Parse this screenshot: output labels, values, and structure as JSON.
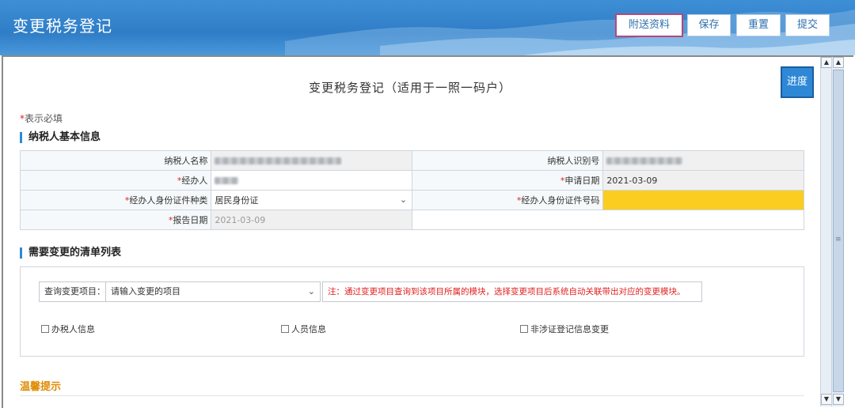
{
  "header": {
    "title": "变更税务登记",
    "buttons": {
      "attach": "附送资料",
      "save": "保存",
      "reset": "重置",
      "submit": "提交"
    }
  },
  "form": {
    "title": "变更税务登记（适用于一照一码户）",
    "progress_button": "进度",
    "required_note_star": "*",
    "required_note": "表示必填",
    "section_basic": "纳税人基本信息",
    "fields": {
      "taxpayer_name_label": "纳税人名称",
      "taxpayer_id_label": "纳税人识别号",
      "agent_label": "经办人",
      "apply_date_label": "申请日期",
      "apply_date_value": "2021-03-09",
      "agent_id_type_label": "经办人身份证件种类",
      "agent_id_type_value": "居民身份证",
      "agent_id_no_label": "经办人身份证件号码",
      "report_date_label": "报告日期",
      "report_date_value": "2021-03-09"
    },
    "section_changes": "需要变更的清单列表",
    "query": {
      "label": "查询变更项目：",
      "placeholder": "请输入变更的项目",
      "note": "注：通过变更项目查询到该项目所属的模块，选择变更项目后系统自动关联带出对应的变更模块。"
    },
    "checkboxes": [
      "办税人信息",
      "人员信息",
      "非涉证登记信息变更"
    ],
    "tips_title": "温馨提示"
  },
  "colors": {
    "header": "#2f7dc6",
    "required": "#e02020",
    "highlight": "#fccd21",
    "tips": "#e08a00"
  }
}
